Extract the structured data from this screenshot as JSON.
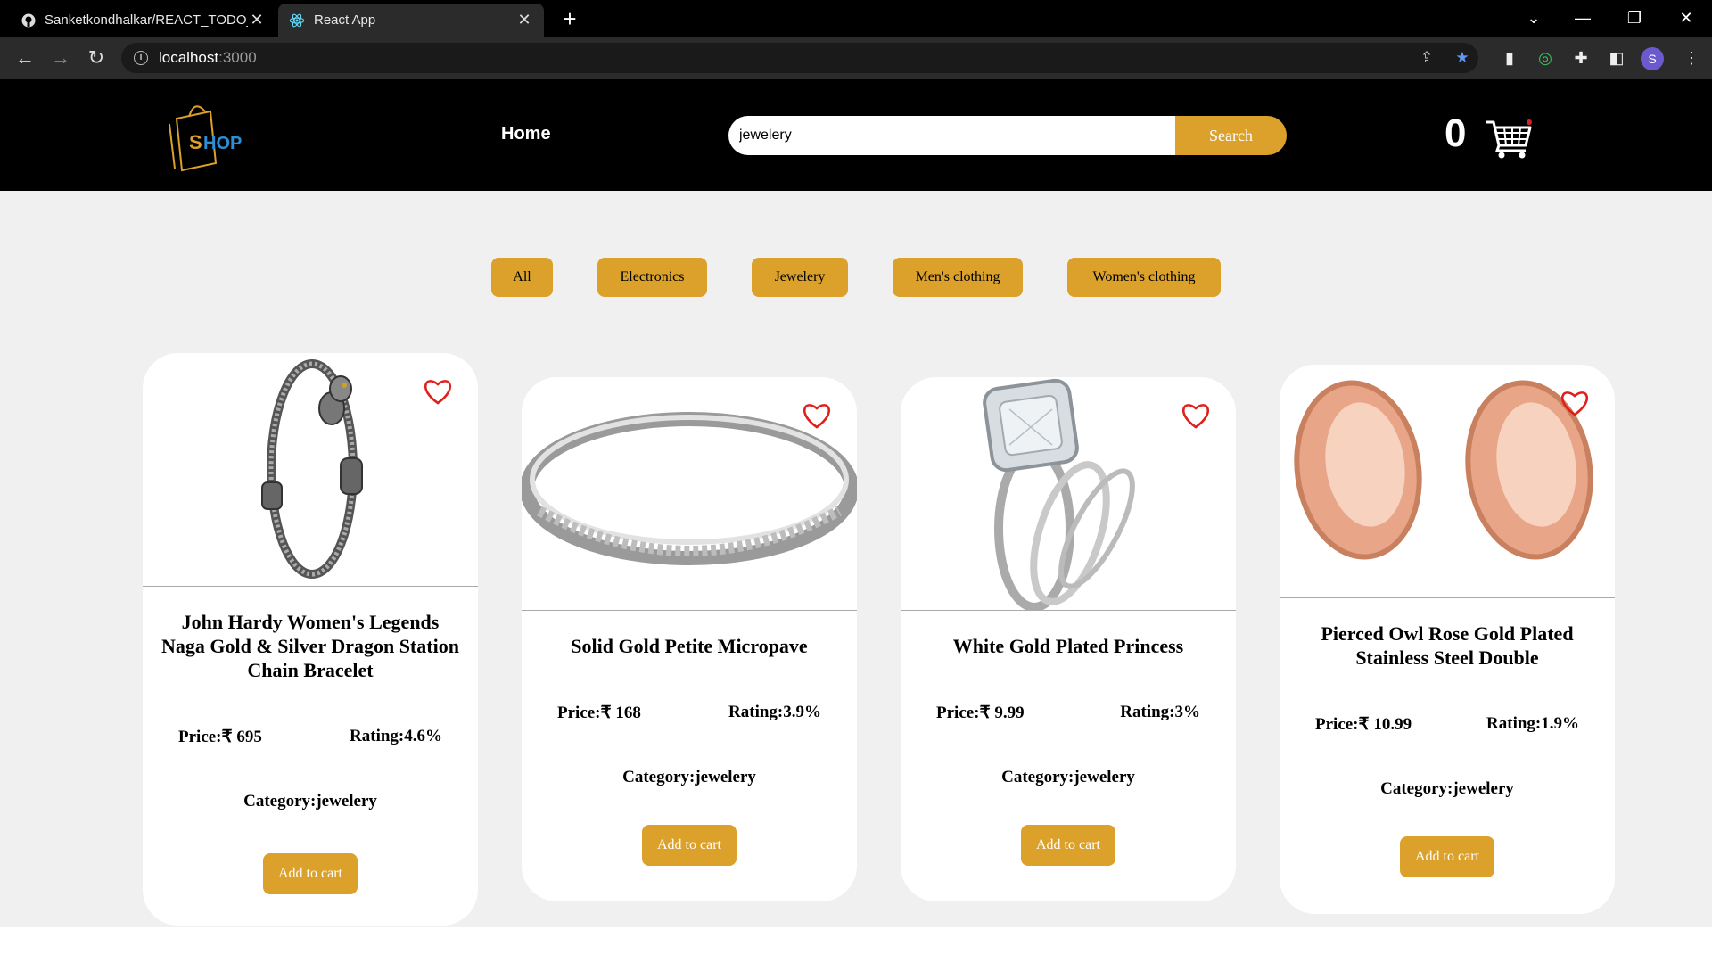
{
  "browser": {
    "tabs": [
      {
        "title": "Sanketkondhalkar/REACT_TODO_",
        "icon": "github-icon"
      },
      {
        "title": "React App",
        "icon": "react-icon"
      }
    ],
    "url_host": "localhost",
    "url_port": ":3000"
  },
  "header": {
    "logo_text": "SHOP",
    "home_label": "Home",
    "search_value": "jewelery",
    "search_button": "Search",
    "cart_count": "0"
  },
  "filters": [
    "All",
    "Electronics",
    "Jewelery",
    "Men's clothing",
    "Women's clothing"
  ],
  "products": [
    {
      "title": "John Hardy Women's Legends Naga Gold & Silver Dragon Station Chain Bracelet",
      "price": "Price:₹ 695",
      "rating": "Rating:4.6%",
      "category": "Category:jewelery",
      "button": "Add to cart",
      "image": "bracelet-image"
    },
    {
      "title": "Solid Gold Petite Micropave",
      "price": "Price:₹ 168",
      "rating": "Rating:3.9%",
      "category": "Category:jewelery",
      "button": "Add to cart",
      "image": "ring-image"
    },
    {
      "title": "White Gold Plated Princess",
      "price": "Price:₹ 9.99",
      "rating": "Rating:3%",
      "category": "Category:jewelery",
      "button": "Add to cart",
      "image": "diamond-ring-image"
    },
    {
      "title": "Pierced Owl Rose Gold Plated Stainless Steel Double",
      "price": "Price:₹ 10.99",
      "rating": "Rating:1.9%",
      "category": "Category:jewelery",
      "button": "Add to cart",
      "image": "rose-gold-plugs-image"
    }
  ],
  "colors": {
    "accent": "#dba12a",
    "header_bg": "#000000",
    "page_bg": "#f0f0f0",
    "heart": "#e0201b"
  }
}
